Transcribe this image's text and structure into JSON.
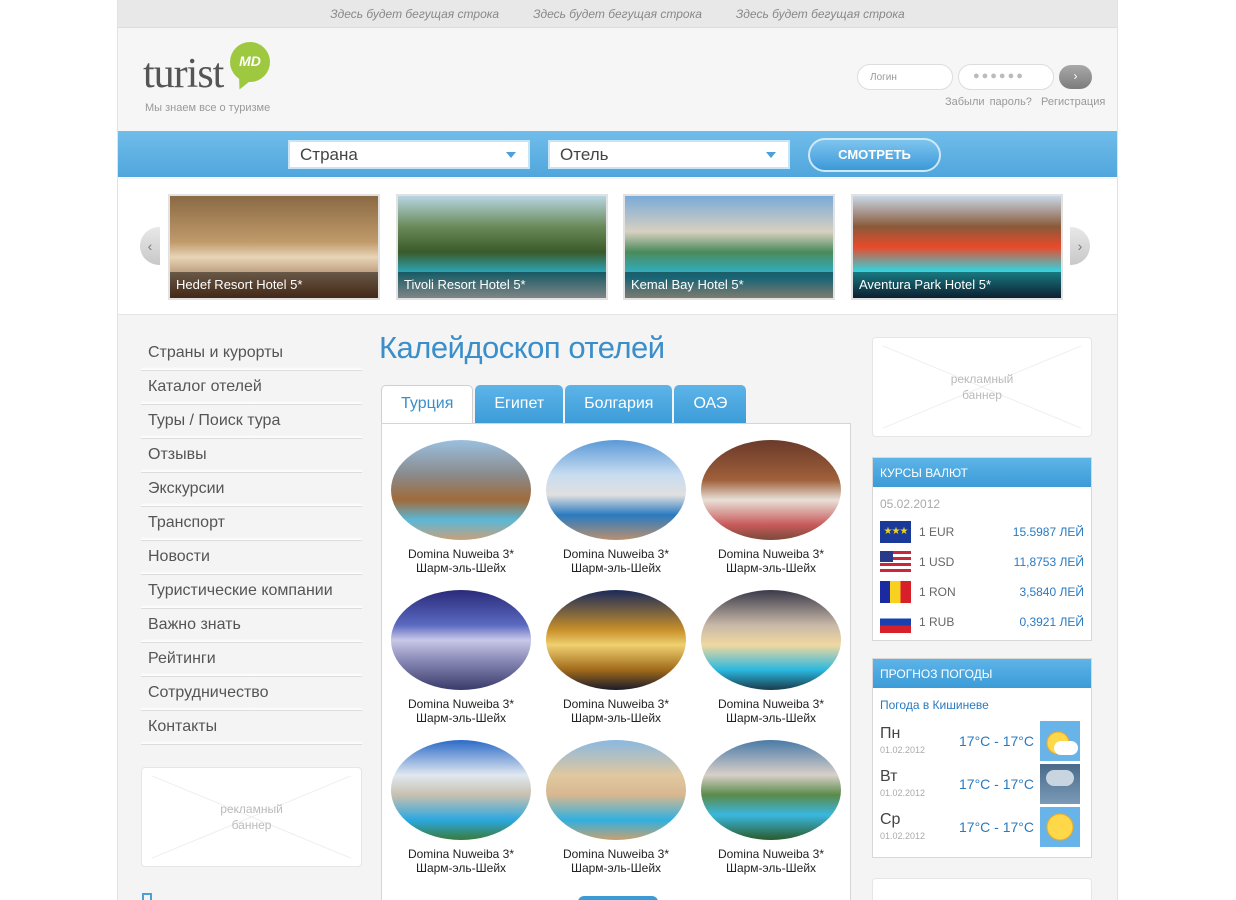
{
  "ticker": [
    "Здесь будет бегущая строка",
    "Здесь будет бегущая строка",
    "Здесь будет бегущая строка"
  ],
  "logo": {
    "word": "turist",
    "badge": "MD",
    "tagline": "Мы знаем все о туризме"
  },
  "auth": {
    "login_placeholder": "Логин",
    "password_mask": "●●●●●●",
    "go_label": "›",
    "forgot": "Забыли пароль?",
    "register": "Регистрация"
  },
  "search": {
    "country": "Страна",
    "hotel": "Отель",
    "button": "СМОТРЕТЬ"
  },
  "slider": {
    "prev": "‹",
    "next": "›",
    "slides": [
      {
        "caption": "Hedef Resort Hotel 5*"
      },
      {
        "caption": "Tivoli Resort Hotel 5*"
      },
      {
        "caption": "Kemal Bay Hotel 5*"
      },
      {
        "caption": "Aventura Park Hotel 5*"
      }
    ]
  },
  "nav": [
    "Страны и курорты",
    "Каталог отелей",
    "Туры / Поиск тура",
    "Отзывы",
    "Экскурсии",
    "Транспорт",
    "Новости",
    "Туристические компании",
    "Важно знать",
    "Рейтинги",
    "Сотрудничество",
    "Контакты"
  ],
  "banner_text": "рекламный баннер",
  "main": {
    "title": "Калейдоскоп отелей",
    "tabs": [
      "Турция",
      "Египет",
      "Болгария",
      "ОАЭ"
    ],
    "hotels": [
      {
        "name": "Domina Nuweiba 3*",
        "city": "Шарм-эль-Шейх"
      },
      {
        "name": "Domina Nuweiba 3*",
        "city": "Шарм-эль-Шейх"
      },
      {
        "name": "Domina Nuweiba 3*",
        "city": "Шарм-эль-Шейх"
      },
      {
        "name": "Domina Nuweiba 3*",
        "city": "Шарм-эль-Шейх"
      },
      {
        "name": "Domina Nuweiba 3*",
        "city": "Шарм-эль-Шейх"
      },
      {
        "name": "Domina Nuweiba 3*",
        "city": "Шарм-эль-Шейх"
      },
      {
        "name": "Domina Nuweiba 3*",
        "city": "Шарм-эль-Шейх"
      },
      {
        "name": "Domina Nuweiba 3*",
        "city": "Шарм-эль-Шейх"
      },
      {
        "name": "Domina Nuweiba 3*",
        "city": "Шарм-эль-Шейх"
      }
    ]
  },
  "currency": {
    "title": "Курсы валют",
    "date": "05.02.2012",
    "rows": [
      {
        "code": "1 EUR",
        "value": "15.5987 ЛЕЙ",
        "flag": "eu"
      },
      {
        "code": "1 USD",
        "value": "11,8753 ЛЕЙ",
        "flag": "us"
      },
      {
        "code": "1 RON",
        "value": "3,5840 ЛЕЙ",
        "flag": "ro"
      },
      {
        "code": "1 RUB",
        "value": "0,3921 ЛЕЙ",
        "flag": "ru"
      }
    ]
  },
  "weather": {
    "title": "Прогноз погоды",
    "city": "Погода в Кишиневе",
    "days": [
      {
        "day": "Пн",
        "date": "01.02.2012",
        "temp": "17°C - 17°C",
        "icon": "partly-cloudy-icon"
      },
      {
        "day": "Вт",
        "date": "01.02.2012",
        "temp": "17°C - 17°C",
        "icon": "storm-icon"
      },
      {
        "day": "Ср",
        "date": "01.02.2012",
        "temp": "17°C - 17°C",
        "icon": "sunny-icon"
      }
    ]
  },
  "colors": {
    "accent": "#4aa5dd",
    "link": "#2a7ac0",
    "title": "#3a8ec9",
    "logo_badge": "#9dc83f"
  }
}
